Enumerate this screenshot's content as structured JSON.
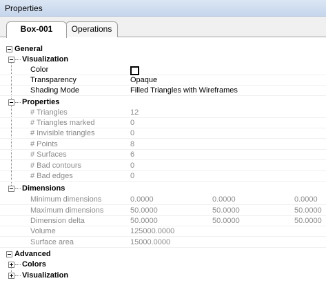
{
  "window": {
    "title": "Properties"
  },
  "tabs": [
    {
      "label": "Box-001"
    },
    {
      "label": "Operations"
    }
  ],
  "general": {
    "label": "General",
    "visualization": {
      "label": "Visualization",
      "rows": [
        {
          "label": "Color",
          "value": ""
        },
        {
          "label": "Transparency",
          "value": "Opaque"
        },
        {
          "label": "Shading Mode",
          "value": "Filled Triangles with Wireframes"
        }
      ]
    },
    "properties": {
      "label": "Properties",
      "rows": [
        {
          "label": "# Triangles",
          "value": "12"
        },
        {
          "label": "# Triangles marked",
          "value": "0"
        },
        {
          "label": "# Invisible triangles",
          "value": "0"
        },
        {
          "label": "# Points",
          "value": "8"
        },
        {
          "label": "# Surfaces",
          "value": "6"
        },
        {
          "label": "# Bad contours",
          "value": "0"
        },
        {
          "label": "# Bad edges",
          "value": "0"
        }
      ]
    },
    "dimensions": {
      "label": "Dimensions",
      "rows": [
        {
          "label": "Minimum dimensions",
          "v1": "0.0000",
          "v2": "0.0000",
          "v3": "0.0000"
        },
        {
          "label": "Maximum dimensions",
          "v1": "50.0000",
          "v2": "50.0000",
          "v3": "50.0000"
        },
        {
          "label": "Dimension delta",
          "v1": "50.0000",
          "v2": "50.0000",
          "v3": "50.0000"
        },
        {
          "label": "Volume",
          "v1": "125000.0000",
          "v2": "",
          "v3": ""
        },
        {
          "label": "Surface area",
          "v1": "15000.0000",
          "v2": "",
          "v3": ""
        }
      ]
    }
  },
  "advanced": {
    "label": "Advanced",
    "colors": {
      "label": "Colors"
    },
    "visualization": {
      "label": "Visualization"
    }
  },
  "colors": {
    "titlebar": "#c6d6ec",
    "panel": "#ffffff",
    "readonly_text": "#8a8a8a",
    "swatch": "#ffffff"
  },
  "icons": {
    "collapse": "minus-box",
    "expand": "plus-box"
  }
}
